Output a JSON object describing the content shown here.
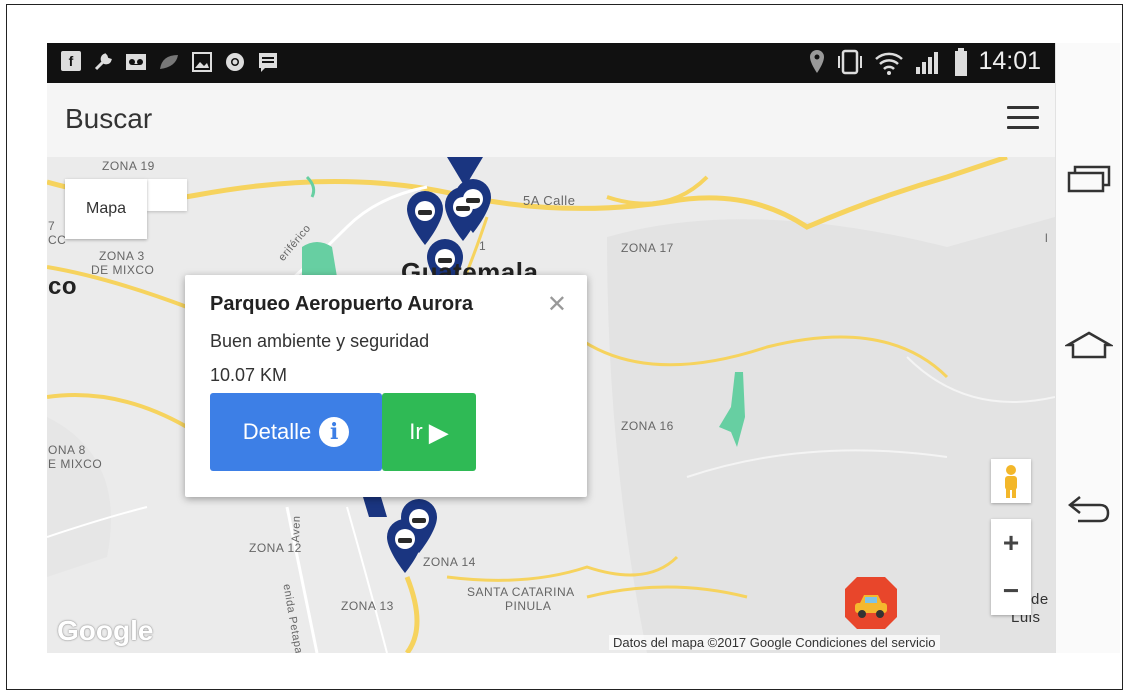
{
  "status_bar": {
    "time": "14:01",
    "left_icons": [
      "facebook-icon",
      "wrench-icon",
      "voicemail-icon",
      "leaf-icon",
      "image-icon",
      "chrome-icon",
      "message-icon"
    ],
    "right_icons": [
      "location-pin-icon",
      "vibrate-icon",
      "wifi-icon",
      "signal-icon",
      "battery-icon"
    ]
  },
  "app_bar": {
    "title": "Buscar"
  },
  "map": {
    "type_button_label": "Mapa",
    "labels": {
      "zona19": "ZONA 19",
      "zona3": "ZONA 3",
      "demixco": "DE MIXCO",
      "co": "co",
      "cc": "CC",
      "seven": "7",
      "calle": "5A Calle",
      "zona17": "ZONA 17",
      "zona16": "ZONA 16",
      "zona8a": "ONA 8",
      "zona8b": "E MIXCO",
      "zona12": "ZONA 12",
      "zona14": "ZONA 14",
      "zona13": "ZONA 13",
      "santa1": "SANTA CATARINA",
      "santa2": "PINULA",
      "periferico": "eriférico",
      "avenida": "Aven",
      "petapa": "enida Petapa",
      "guatemala": "Guatemala",
      "one": "1",
      "l": "l",
      "de": "de",
      "luis": "Luis",
      "google": "Google"
    },
    "attribution": "Datos del mapa ©2017 Google    Condiciones del servicio",
    "zoom_in": "+",
    "zoom_out": "−"
  },
  "info_window": {
    "title": "Parqueo Aeropuerto Aurora",
    "close": "✕",
    "description": "Buen ambiente y seguridad",
    "distance": "10.07 KM",
    "detail_label": "Detalle",
    "detail_icon_glyph": "i",
    "go_label": "Ir",
    "go_icon_glyph": "▶"
  },
  "colors": {
    "marker": "#1a3580",
    "detail_button": "#3d7fe6",
    "go_button": "#2fba55",
    "fab": "#e8462b"
  }
}
